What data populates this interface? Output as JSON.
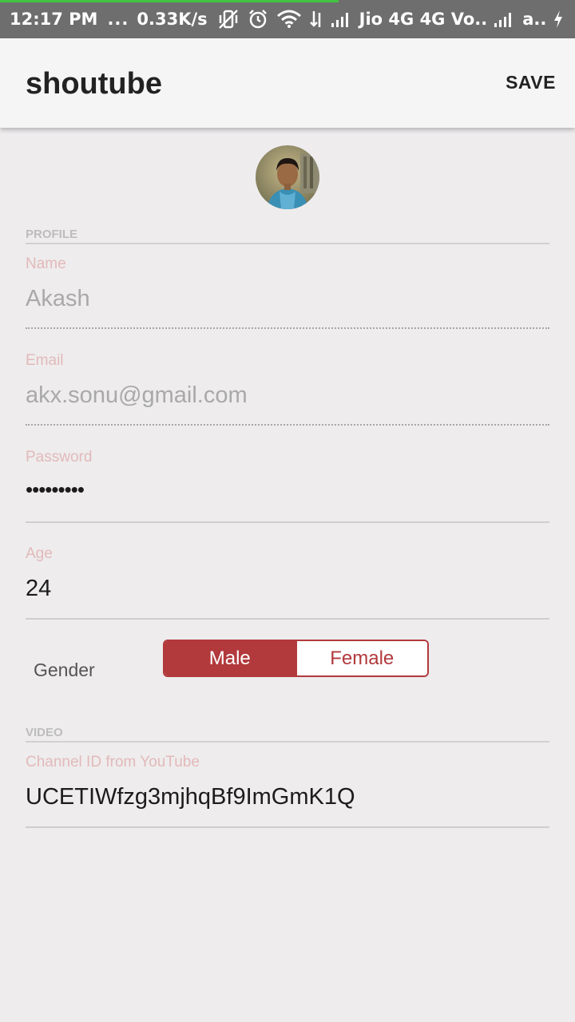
{
  "status_bar": {
    "time": "12:17 PM",
    "dots": "...",
    "speed": "0.33K/s",
    "carrier1": "Jio 4G 4G Vo..",
    "carrier2": "a..",
    "progress_color": "#43c343"
  },
  "app_bar": {
    "title": "shoutube",
    "save_label": "SAVE"
  },
  "sections": {
    "profile_header": "PROFILE",
    "video_header": "VIDEO"
  },
  "fields": {
    "name": {
      "label": "Name",
      "value": "Akash"
    },
    "email": {
      "label": "Email",
      "value": "akx.sonu@gmail.com"
    },
    "password": {
      "label": "Password",
      "value": "•••••••••"
    },
    "age": {
      "label": "Age",
      "value": "24"
    },
    "channel": {
      "label": "Channel ID from YouTube",
      "value": "UCETIWfzg3mjhqBf9ImGmK1Q"
    }
  },
  "gender": {
    "label": "Gender",
    "options": [
      "Male",
      "Female"
    ],
    "selected": "Male"
  },
  "colors": {
    "accent": "#b2393c",
    "label": "#e3b9ba",
    "background": "#eeeced"
  }
}
